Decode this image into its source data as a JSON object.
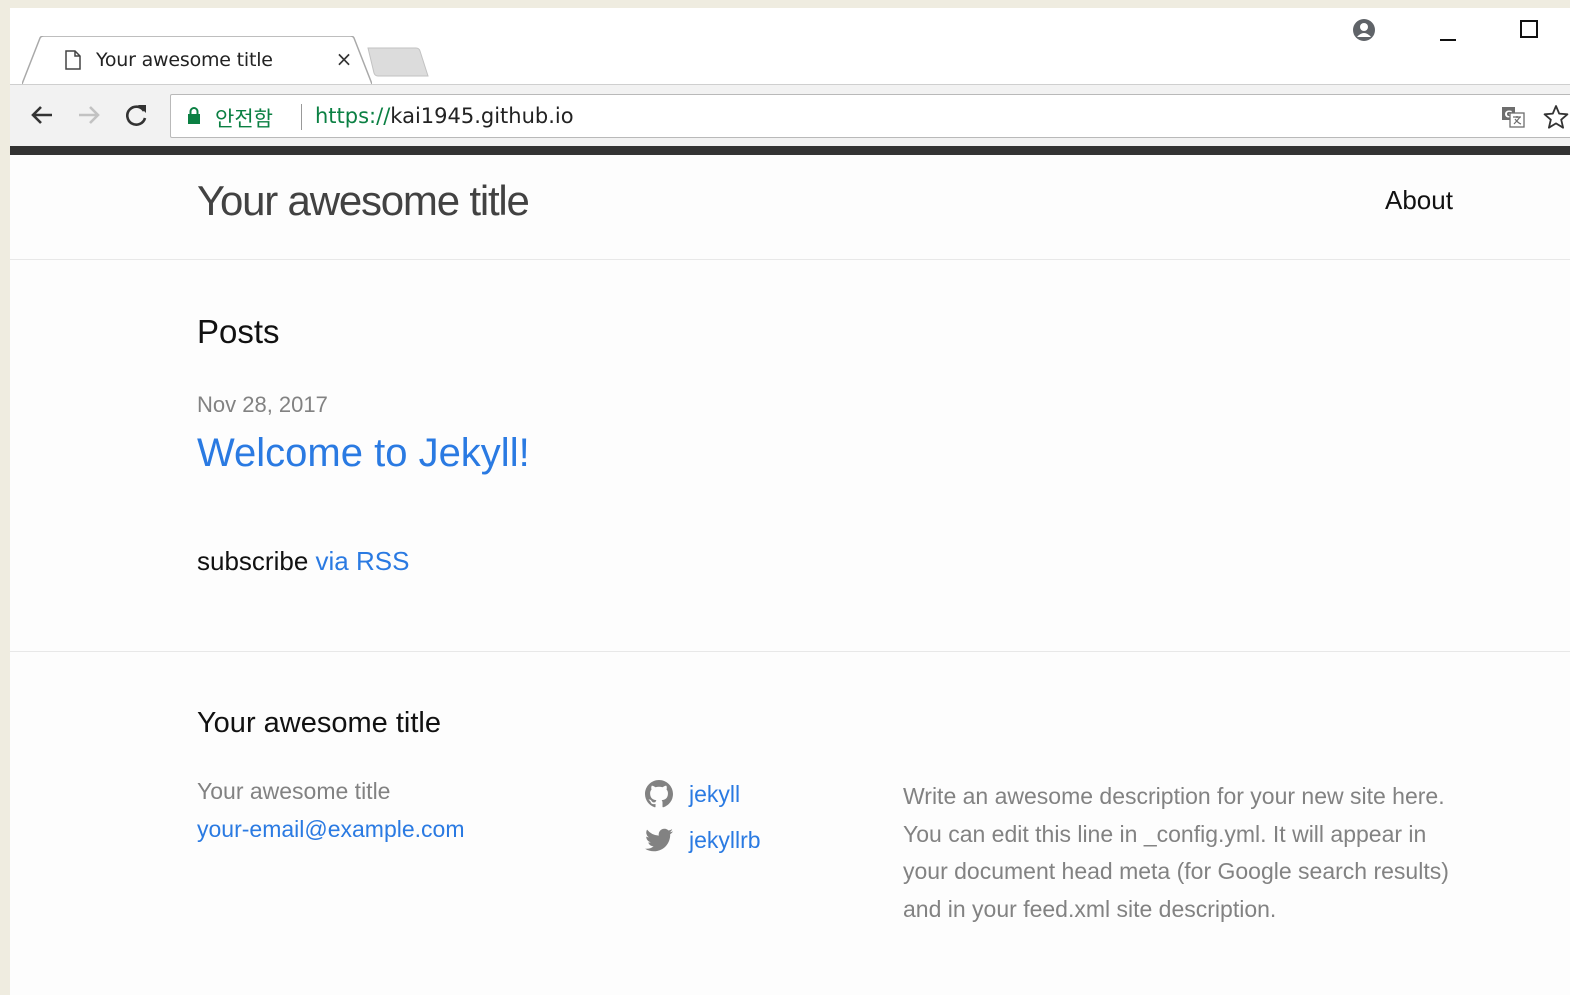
{
  "browser": {
    "tab_title": "Your awesome title",
    "tab_close": "×",
    "secure_label": "안전함",
    "url_scheme": "https://",
    "url_host": "kai1945.github.io"
  },
  "site": {
    "title": "Your awesome title",
    "nav": {
      "about": "About"
    }
  },
  "main": {
    "posts_heading": "Posts",
    "posts": [
      {
        "date": "Nov 28, 2017",
        "title": "Welcome to Jekyll!"
      }
    ],
    "subscribe_text": "subscribe",
    "subscribe_link": "via RSS"
  },
  "footer": {
    "heading": "Your awesome title",
    "name": "Your awesome title",
    "email": "your-email@example.com",
    "social": [
      {
        "icon": "github-icon",
        "label": "jekyll"
      },
      {
        "icon": "twitter-icon",
        "label": "jekyllrb"
      }
    ],
    "description": "Write an awesome description for your new site here. You can edit this line in _config.yml. It will appear in your document head meta (for Google search results) and in your feed.xml site description."
  },
  "colors": {
    "link": "#2a7ae2",
    "secure": "#0b8043",
    "muted": "#828282",
    "header_bar": "#333333"
  }
}
